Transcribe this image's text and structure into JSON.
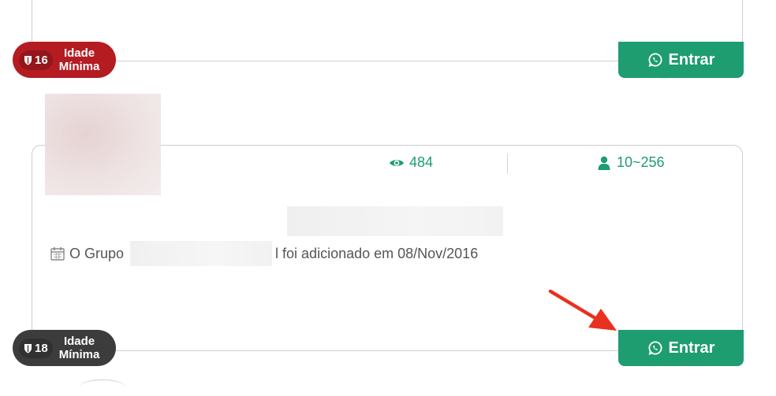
{
  "cards": [
    {
      "age_badge": {
        "number": "16",
        "line1": "Idade",
        "line2": "Mínima",
        "color": "#b51c22"
      },
      "enter_button": {
        "label": "Entrar",
        "color": "#1d9d70"
      }
    },
    {
      "stats": {
        "views": "484",
        "members": "10~256"
      },
      "added_line": {
        "prefix": "O Grupo",
        "suffix": "l foi adicionado em 08/Nov/2016"
      },
      "age_badge": {
        "number": "18",
        "line1": "Idade",
        "line2": "Mínima",
        "color": "#3c3c3c"
      },
      "enter_button": {
        "label": "Entrar",
        "color": "#1d9d70"
      }
    }
  ],
  "annotation": {
    "arrow_color": "#e8311f"
  },
  "icons": [
    "shield-icon",
    "whatsapp-icon",
    "eye-icon",
    "user-icon",
    "calendar-icon"
  ]
}
